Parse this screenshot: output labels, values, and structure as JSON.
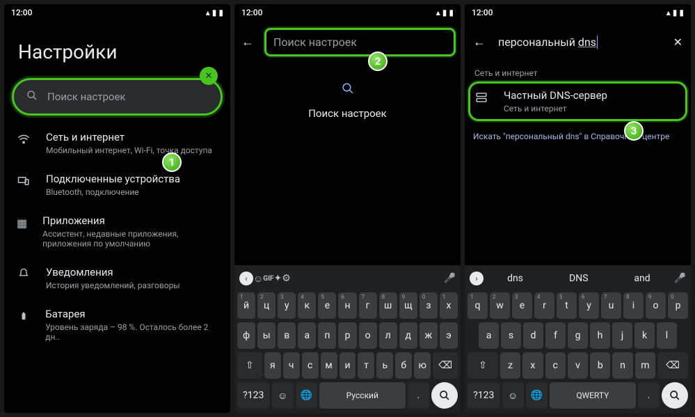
{
  "status": {
    "time": "12:00"
  },
  "phone1": {
    "title": "Настройки",
    "search_placeholder": "Поиск настроек",
    "items": [
      {
        "title": "Сеть и интернет",
        "sub": "Мобильный интернет, Wi-Fi, точка доступа"
      },
      {
        "title": "Подключенные устройства",
        "sub": "Bluetooth, подключение"
      },
      {
        "title": "Приложения",
        "sub": "Ассистент, недавные приложения, приложения по умолчанию"
      },
      {
        "title": "Уведомления",
        "sub": "История уведомлений, разговоры"
      },
      {
        "title": "Батарея",
        "sub": "Уровень заряда – 98 %. Осталось более 2 дн.."
      }
    ]
  },
  "phone2": {
    "search_placeholder": "Поиск настроек",
    "empty_message": "Поиск настроек",
    "keyboard": {
      "row1": [
        "й",
        "ц",
        "у",
        "к",
        "е",
        "н",
        "г",
        "ш",
        "щ",
        "з",
        "х"
      ],
      "row2": [
        "ф",
        "ы",
        "в",
        "а",
        "п",
        "р",
        "о",
        "л",
        "д",
        "ж",
        "э"
      ],
      "row3": [
        "я",
        "ч",
        "с",
        "м",
        "и",
        "т",
        "ь",
        "б",
        "ю"
      ],
      "numkey": "?123",
      "space": "Русский"
    }
  },
  "phone3": {
    "query_prefix": "персональный ",
    "query_underlined": "dns",
    "section": "Сеть и интернет",
    "result": {
      "title": "Частный DNS-сервер",
      "sub": "Сеть и интернет"
    },
    "help_link": "Искать \"персональный dns\" в Справочном центре",
    "keyboard": {
      "suggestions": [
        "dns",
        "DNS",
        "and"
      ],
      "row1": [
        "q",
        "w",
        "e",
        "r",
        "t",
        "y",
        "u",
        "i",
        "o",
        "p"
      ],
      "row2": [
        "a",
        "s",
        "d",
        "f",
        "g",
        "h",
        "j",
        "k",
        "l"
      ],
      "row3": [
        "z",
        "x",
        "c",
        "v",
        "b",
        "n",
        "m"
      ],
      "numkey": "?123",
      "space": "QWERTY"
    }
  },
  "badges": {
    "one": "1",
    "two": "2",
    "three": "3"
  }
}
